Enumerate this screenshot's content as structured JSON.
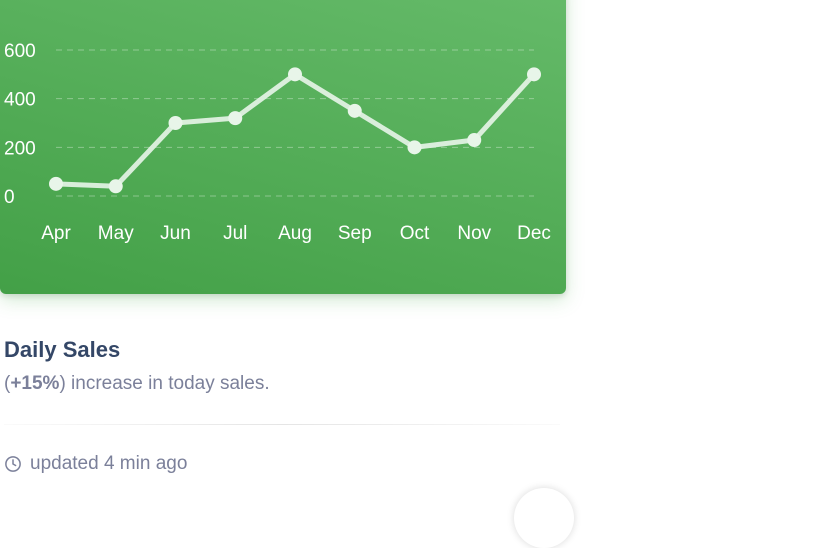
{
  "card": {
    "title": "Daily Sales",
    "description_open": "(",
    "description_pct": "+15%",
    "description_rest": ") increase in today sales.",
    "footer_text": "updated 4 min ago",
    "footer_icon": "clock-icon"
  },
  "colors": {
    "panel_start": "#66bb6a",
    "panel_end": "#43a047",
    "line": "#e8f5e9",
    "text_dark": "#344767",
    "text_muted": "#7b809a"
  },
  "chart_data": {
    "type": "line",
    "categories": [
      "Apr",
      "May",
      "Jun",
      "Jul",
      "Aug",
      "Sep",
      "Oct",
      "Nov",
      "Dec"
    ],
    "values": [
      50,
      40,
      300,
      320,
      500,
      350,
      200,
      230,
      500
    ],
    "yticks": [
      0,
      200,
      400,
      600
    ],
    "ylim": [
      0,
      600
    ],
    "grid": true,
    "title": "",
    "xlabel": "",
    "ylabel": ""
  }
}
